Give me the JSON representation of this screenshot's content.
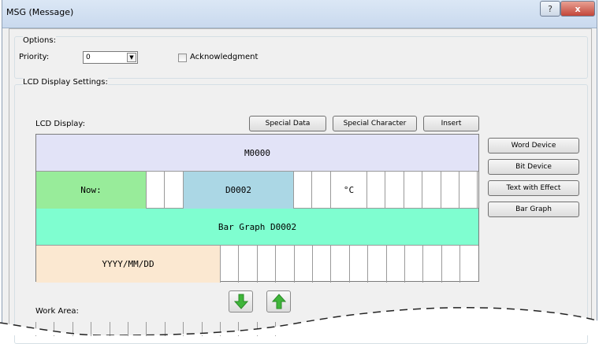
{
  "window": {
    "title": "MSG (Message)",
    "help_label": "?",
    "close_label": "x"
  },
  "options": {
    "legend": "Options:",
    "priority_label": "Priority:",
    "priority_value": "0",
    "acknowledgment_label": "Acknowledgment",
    "acknowledgment_checked": false
  },
  "lcd_settings": {
    "legend": "LCD Display Settings:",
    "lcd_display_label": "LCD Display:",
    "special_data_label": "Special Data",
    "special_character_label": "Special Character",
    "insert_label": "Insert",
    "work_area_label": "Work Area:"
  },
  "side_buttons": {
    "word_device": "Word Device",
    "bit_device": "Bit Device",
    "text_with_effect": "Text with Effect",
    "bar_graph": "Bar Graph"
  },
  "lcd_rows": {
    "row1": "M0000",
    "row2_now": "Now:",
    "row2_device": "D0002",
    "row2_unit": "°C",
    "row3": "Bar Graph D0002",
    "row4": "YYYY/MM/DD"
  },
  "colors": {
    "row1_bg": "#e2e3f7",
    "now_bg": "#98ec9a",
    "device_bg": "#abd7e5",
    "bar_graph_bg": "#7ffed0",
    "date_bg": "#fbe8d1",
    "arrow_green": "#3fb53a"
  },
  "icons": {
    "down": "arrow-down-icon",
    "up": "arrow-up-icon"
  }
}
